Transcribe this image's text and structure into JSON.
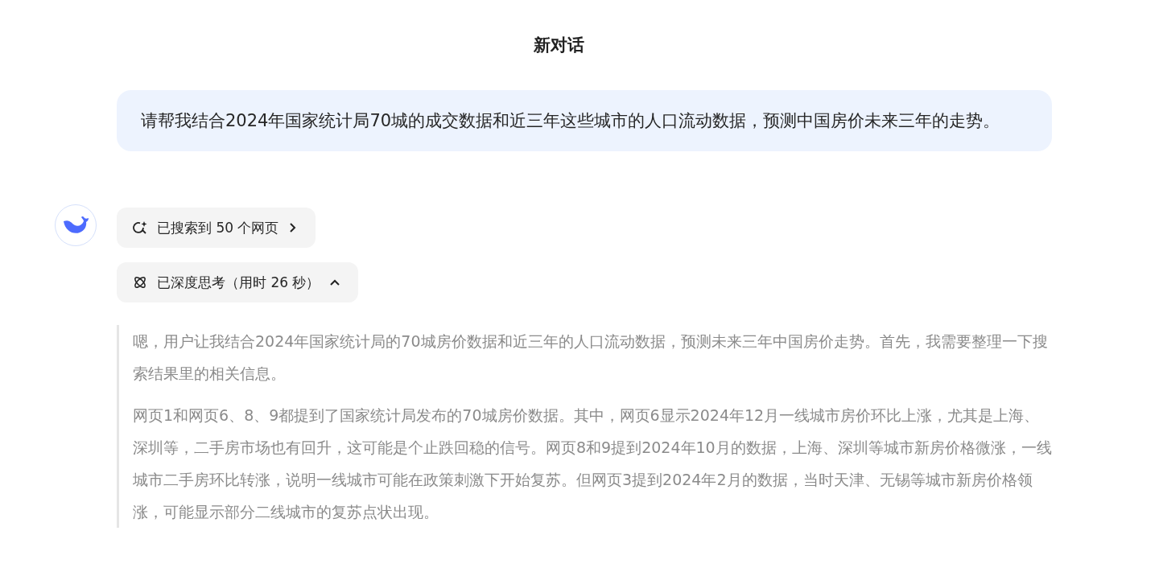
{
  "header": {
    "title": "新对话"
  },
  "user_message": {
    "text": "请帮我结合2024年国家统计局70城的成交数据和近三年这些城市的人口流动数据，预测中国房价未来三年的走势。"
  },
  "reply": {
    "search_chip": {
      "label": "已搜索到 50 个网页"
    },
    "thinking_chip": {
      "label": "已深度思考（用时 26 秒）",
      "expanded": true
    },
    "thoughts": [
      "嗯，用户让我结合2024年国家统计局的70城房价数据和近三年的人口流动数据，预测未来三年中国房价走势。首先，我需要整理一下搜索结果里的相关信息。",
      "网页1和网页6、8、9都提到了国家统计局发布的70城房价数据。其中，网页6显示2024年12月一线城市房价环比上涨，尤其是上海、深圳等，二手房市场也有回升，这可能是个止跌回稳的信号。网页8和9提到2024年10月的数据，上海、深圳等城市新房价格微涨，一线城市二手房环比转涨，说明一线城市可能在政策刺激下开始复苏。但网页3提到2024年2月的数据，当时天津、无锡等城市新房价格领涨，可能显示部分二线城市的复苏点状出现。"
    ]
  }
}
